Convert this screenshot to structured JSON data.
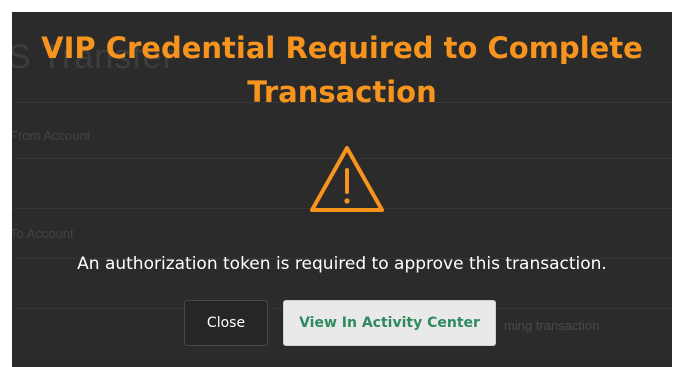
{
  "background_form": {
    "title": "S Transfer",
    "from_label": "From Account",
    "to_label": "To Account",
    "side_text": "ming transaction"
  },
  "dialog": {
    "title": "VIP Credential Required to Complete Transaction",
    "icon": "warning-triangle-icon",
    "message": "An authorization token is required to approve this transaction.",
    "close_label": "Close",
    "activity_label": "View In Activity Center"
  },
  "colors": {
    "title": "#f7941d",
    "overlay": "#2b2b2b",
    "activity_text": "#2f8a5e"
  }
}
